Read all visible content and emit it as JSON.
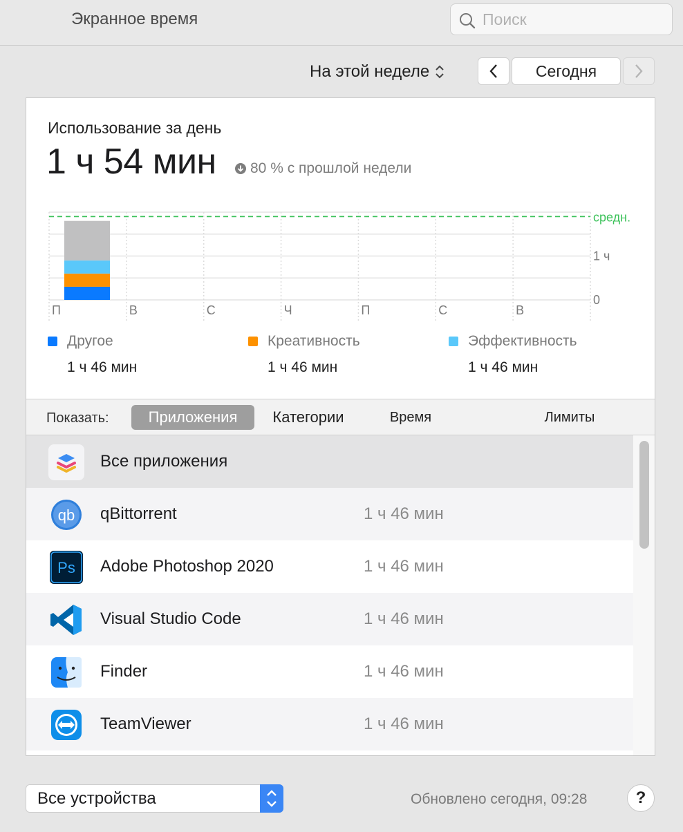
{
  "window": {
    "title": "Экранное время"
  },
  "search": {
    "placeholder": "Поиск"
  },
  "period": {
    "label": "На этой неделе"
  },
  "nav": {
    "today_label": "Сегодня"
  },
  "usage": {
    "title": "Использование за день",
    "total": "1 ч 54 мин",
    "delta": "80 % с прошлой недели"
  },
  "chart_data": {
    "type": "bar",
    "stacked": true,
    "categories": [
      "П",
      "В",
      "С",
      "Ч",
      "П",
      "С",
      "В"
    ],
    "series": [
      {
        "name": "Другое",
        "color": "#0a7aff",
        "values": [
          0.3,
          0,
          0,
          0,
          0,
          0,
          0
        ]
      },
      {
        "name": "Креативность",
        "color": "#fd9100",
        "values": [
          0.3,
          0,
          0,
          0,
          0,
          0,
          0
        ]
      },
      {
        "name": "Эффективность",
        "color": "#5ac8fa",
        "values": [
          0.3,
          0,
          0,
          0,
          0,
          0,
          0
        ]
      },
      {
        "color": "#c0c0c1",
        "values": [
          0.9,
          0,
          0,
          0,
          0,
          0,
          0
        ]
      }
    ],
    "yticks": [
      "0",
      "1 ч"
    ],
    "average_label": "средн.",
    "average_value": 1.9,
    "ylim": [
      0,
      2
    ],
    "grid": true
  },
  "legend": [
    {
      "label": "Другое",
      "value": "1 ч 46 мин",
      "color": "#0a7aff"
    },
    {
      "label": "Креативность",
      "value": "1 ч 46 мин",
      "color": "#fd9100"
    },
    {
      "label": "Эффективность",
      "value": "1 ч 46 мин",
      "color": "#5ac8fa"
    }
  ],
  "tabs": {
    "show_label": "Показать:",
    "items": [
      "Приложения",
      "Категории",
      "Время",
      "Лимиты"
    ],
    "selected": "Приложения"
  },
  "apps": [
    {
      "name": "Все приложения",
      "time": "",
      "icon": "stack-icon"
    },
    {
      "name": "qBittorrent",
      "time": "1 ч 46 мин",
      "icon": "qbittorrent-icon"
    },
    {
      "name": "Adobe Photoshop 2020",
      "time": "1 ч 46 мин",
      "icon": "photoshop-icon"
    },
    {
      "name": "Visual Studio Code",
      "time": "1 ч 46 мин",
      "icon": "vscode-icon"
    },
    {
      "name": "Finder",
      "time": "1 ч 46 мин",
      "icon": "finder-icon"
    },
    {
      "name": "TeamViewer",
      "time": "1 ч 46 мин",
      "icon": "teamviewer-icon"
    }
  ],
  "footer": {
    "device_label": "Все устройства",
    "updated": "Обновлено сегодня, 09:28",
    "help": "?"
  }
}
